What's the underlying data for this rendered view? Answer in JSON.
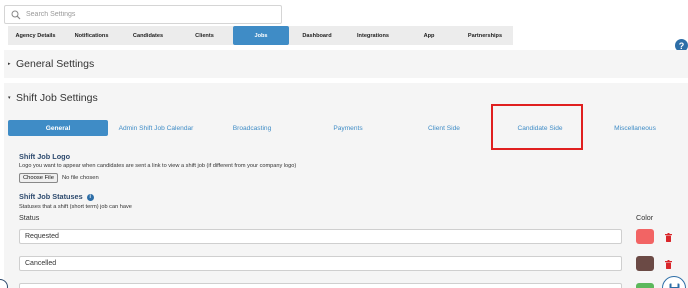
{
  "search": {
    "placeholder": "Search Settings"
  },
  "top_tabs": [
    {
      "label": "Agency Details",
      "active": false
    },
    {
      "label": "Notifications",
      "active": false
    },
    {
      "label": "Candidates",
      "active": false
    },
    {
      "label": "Clients",
      "active": false
    },
    {
      "label": "Jobs",
      "active": true
    },
    {
      "label": "Dashboard",
      "active": false
    },
    {
      "label": "Integrations",
      "active": false
    },
    {
      "label": "App",
      "active": false
    },
    {
      "label": "Partnerships",
      "active": false
    }
  ],
  "help": {
    "icon": "question-circle-icon",
    "label": "?"
  },
  "sections": {
    "general": {
      "title": "General Settings",
      "caret": "▸",
      "expanded": false
    },
    "shift": {
      "title": "Shift Job Settings",
      "caret": "▾",
      "expanded": true
    }
  },
  "sub_tabs": [
    {
      "label": "General",
      "active": true
    },
    {
      "label": "Admin Shift Job Calendar",
      "active": false
    },
    {
      "label": "Broadcasting",
      "active": false
    },
    {
      "label": "Payments",
      "active": false
    },
    {
      "label": "Client Side",
      "active": false
    },
    {
      "label": "Candidate Side",
      "active": false,
      "highlighted": true
    },
    {
      "label": "Miscellaneous",
      "active": false
    }
  ],
  "logo": {
    "title": "Shift Job Logo",
    "description": "Logo you want to appear when candidates are sent a link to view a shift job (if different from your company logo)",
    "choose_label": "Choose File",
    "no_file_label": "No file chosen"
  },
  "statuses": {
    "title": "Shift Job Statuses",
    "info_icon": "info-icon",
    "description": "Statuses that a shift (short term) job can have",
    "status_col": "Status",
    "color_col": "Color",
    "rows": [
      {
        "name": "Requested",
        "color": "#f26464"
      },
      {
        "name": "Cancelled",
        "color": "#6b4a45"
      },
      {
        "name": "",
        "color": "#5cb85c"
      }
    ]
  },
  "colors": {
    "accent": "#3f8cc6",
    "dark_blue": "#2d4a6e",
    "highlight": "#e02020",
    "delete": "#d9262a"
  }
}
